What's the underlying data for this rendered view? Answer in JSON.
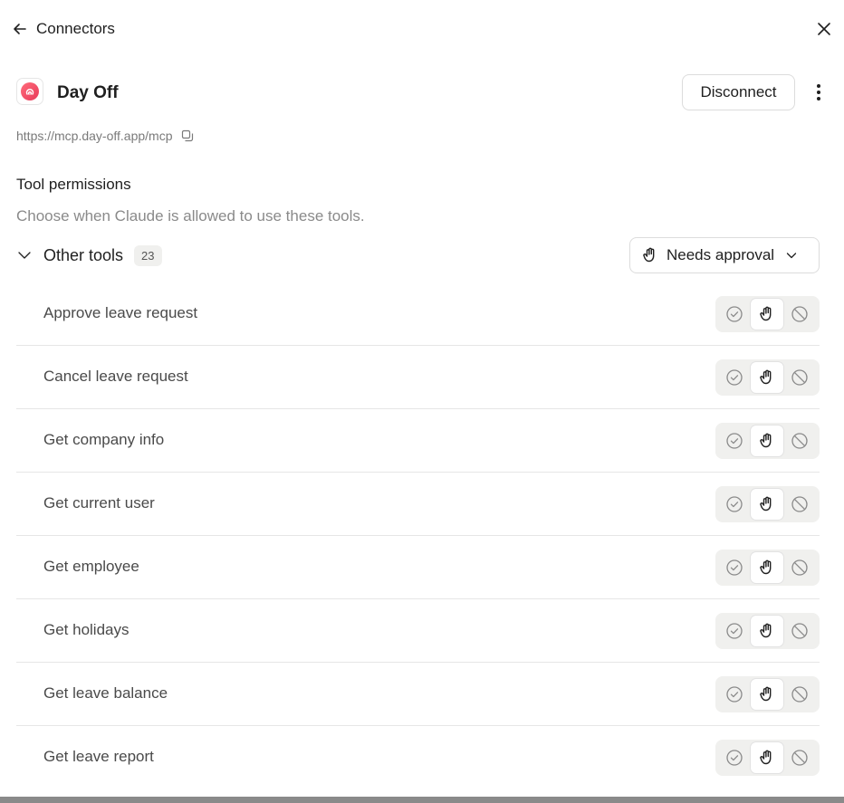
{
  "header": {
    "back_label": "Connectors"
  },
  "connector": {
    "name": "Day Off",
    "url": "https://mcp.day-off.app/mcp",
    "disconnect_label": "Disconnect"
  },
  "permissions": {
    "title": "Tool permissions",
    "description": "Choose when Claude is allowed to use these tools."
  },
  "group": {
    "label": "Other tools",
    "count": "23",
    "selected_option": "Needs approval"
  },
  "tools": [
    {
      "name": "Approve leave request",
      "permission": "needs-approval"
    },
    {
      "name": "Cancel leave request",
      "permission": "needs-approval"
    },
    {
      "name": "Get company info",
      "permission": "needs-approval"
    },
    {
      "name": "Get current user",
      "permission": "needs-approval"
    },
    {
      "name": "Get employee",
      "permission": "needs-approval"
    },
    {
      "name": "Get holidays",
      "permission": "needs-approval"
    },
    {
      "name": "Get leave balance",
      "permission": "needs-approval"
    },
    {
      "name": "Get leave report",
      "permission": "needs-approval"
    }
  ],
  "icons": {
    "back": "arrow-left-icon",
    "close": "close-icon",
    "more": "more-vertical-icon",
    "copy": "copy-icon",
    "collapse": "chevron-down-icon",
    "allow": "check-circle-icon",
    "approval": "hand-icon",
    "block": "block-icon"
  },
  "colors": {
    "logo_accent": "#e83a5a",
    "muted_text": "#8a8a8a",
    "segment_bg": "#f0f0ee"
  }
}
